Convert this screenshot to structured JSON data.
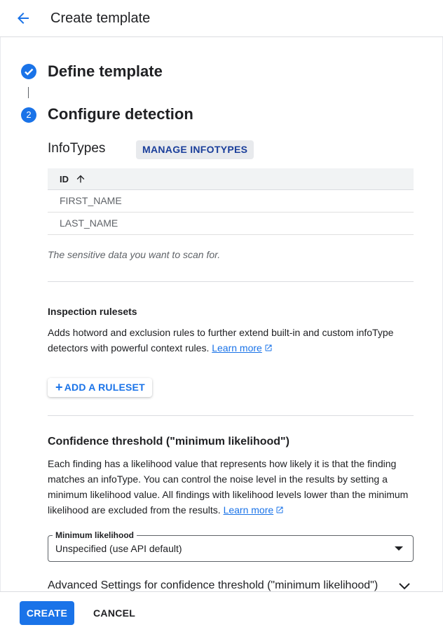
{
  "header": {
    "title": "Create template"
  },
  "steps": [
    {
      "number": "1",
      "title": "Define template",
      "status": "completed"
    },
    {
      "number": "2",
      "title": "Configure detection",
      "status": "active"
    }
  ],
  "infotypes": {
    "label": "InfoTypes",
    "manage_label": "MANAGE INFOTYPES",
    "table": {
      "columns": [
        "ID"
      ],
      "sort_direction": "ascending",
      "rows": [
        "FIRST_NAME",
        "LAST_NAME"
      ]
    },
    "hint": "The sensitive data you want to scan for."
  },
  "inspection_rulesets": {
    "title": "Inspection rulesets",
    "description": "Adds hotword and exclusion rules to further extend built-in and custom infoType detectors with powerful context rules.",
    "link": "Learn more",
    "add_label": "ADD A RULESET"
  },
  "confidence": {
    "title": "Confidence threshold (\"minimum likelihood\")",
    "description": "Each finding has a likelihood value that represents how likely it is that the finding matches an infoType. You can control the noise level in the results by setting a minimum likelihood value. All findings with likelihood levels lower than the minimum likelihood are excluded from the results.",
    "link": "Learn more",
    "select_label": "Minimum likelihood",
    "select_value": "Unspecified (use API default)",
    "advanced_label": "Advanced Settings for confidence threshold (\"minimum likelihood\")"
  },
  "footer": {
    "create_label": "CREATE",
    "cancel_label": "CANCEL"
  },
  "colors": {
    "accent": "#1a73e8",
    "text": "#202124",
    "muted": "#5f6368"
  }
}
